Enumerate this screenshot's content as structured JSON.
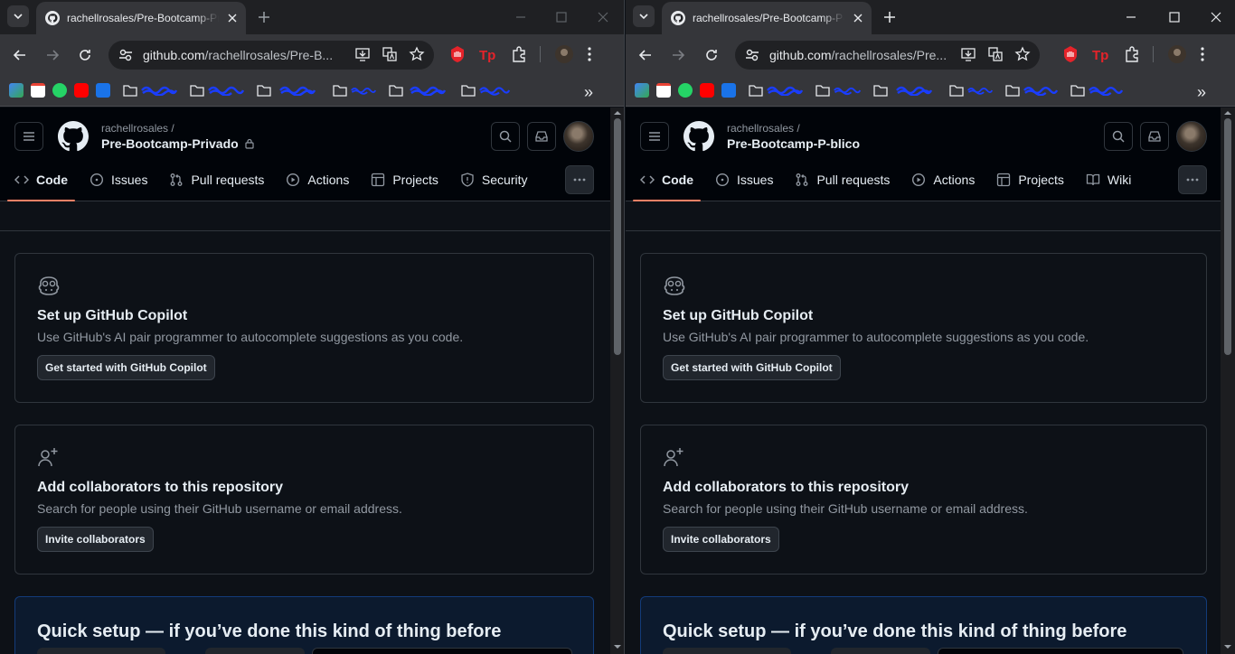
{
  "left_window": {
    "tab": {
      "title": "rachellrosales/Pre-Bootcamp-Privado"
    },
    "omnibox": {
      "host": "github.com",
      "path": "/rachellrosales/Pre-B..."
    },
    "repo": {
      "owner": "rachellrosales /",
      "name": "Pre-Bootcamp-Privado",
      "private": true
    },
    "nav": [
      {
        "label": "Code",
        "icon": "code-icon",
        "active": true
      },
      {
        "label": "Issues",
        "icon": "issue-opened-icon"
      },
      {
        "label": "Pull requests",
        "icon": "git-pull-request-icon"
      },
      {
        "label": "Actions",
        "icon": "play-icon"
      },
      {
        "label": "Projects",
        "icon": "table-icon"
      },
      {
        "label": "Security",
        "icon": "shield-icon"
      }
    ]
  },
  "right_window": {
    "tab": {
      "title": "rachellrosales/Pre-Bootcamp-P-blico"
    },
    "omnibox": {
      "host": "github.com",
      "path": "/rachellrosales/Pre..."
    },
    "repo": {
      "owner": "rachellrosales /",
      "name": "Pre-Bootcamp-P-blico",
      "private": false
    },
    "nav": [
      {
        "label": "Code",
        "icon": "code-icon",
        "active": true
      },
      {
        "label": "Issues",
        "icon": "issue-opened-icon"
      },
      {
        "label": "Pull requests",
        "icon": "git-pull-request-icon"
      },
      {
        "label": "Actions",
        "icon": "play-icon"
      },
      {
        "label": "Projects",
        "icon": "table-icon"
      },
      {
        "label": "Wiki",
        "icon": "book-icon"
      }
    ]
  },
  "cards": {
    "copilot": {
      "title": "Set up GitHub Copilot",
      "description": "Use GitHub's AI pair programmer to autocomplete suggestions as you code.",
      "button": "Get started with GitHub Copilot"
    },
    "collaborators": {
      "title": "Add collaborators to this repository",
      "description": "Search for people using their GitHub username or email address.",
      "button": "Invite collaborators"
    },
    "quick_setup": {
      "title": "Quick setup — if you’ve done this kind of thing before"
    }
  },
  "colors": {
    "page_bg": "#0d1117",
    "header_bg": "#010409",
    "border": "#30363d",
    "active_tab_underline": "#f78166",
    "chrome_toolbar": "#35363a",
    "chrome_tabstrip": "#1f2023"
  }
}
